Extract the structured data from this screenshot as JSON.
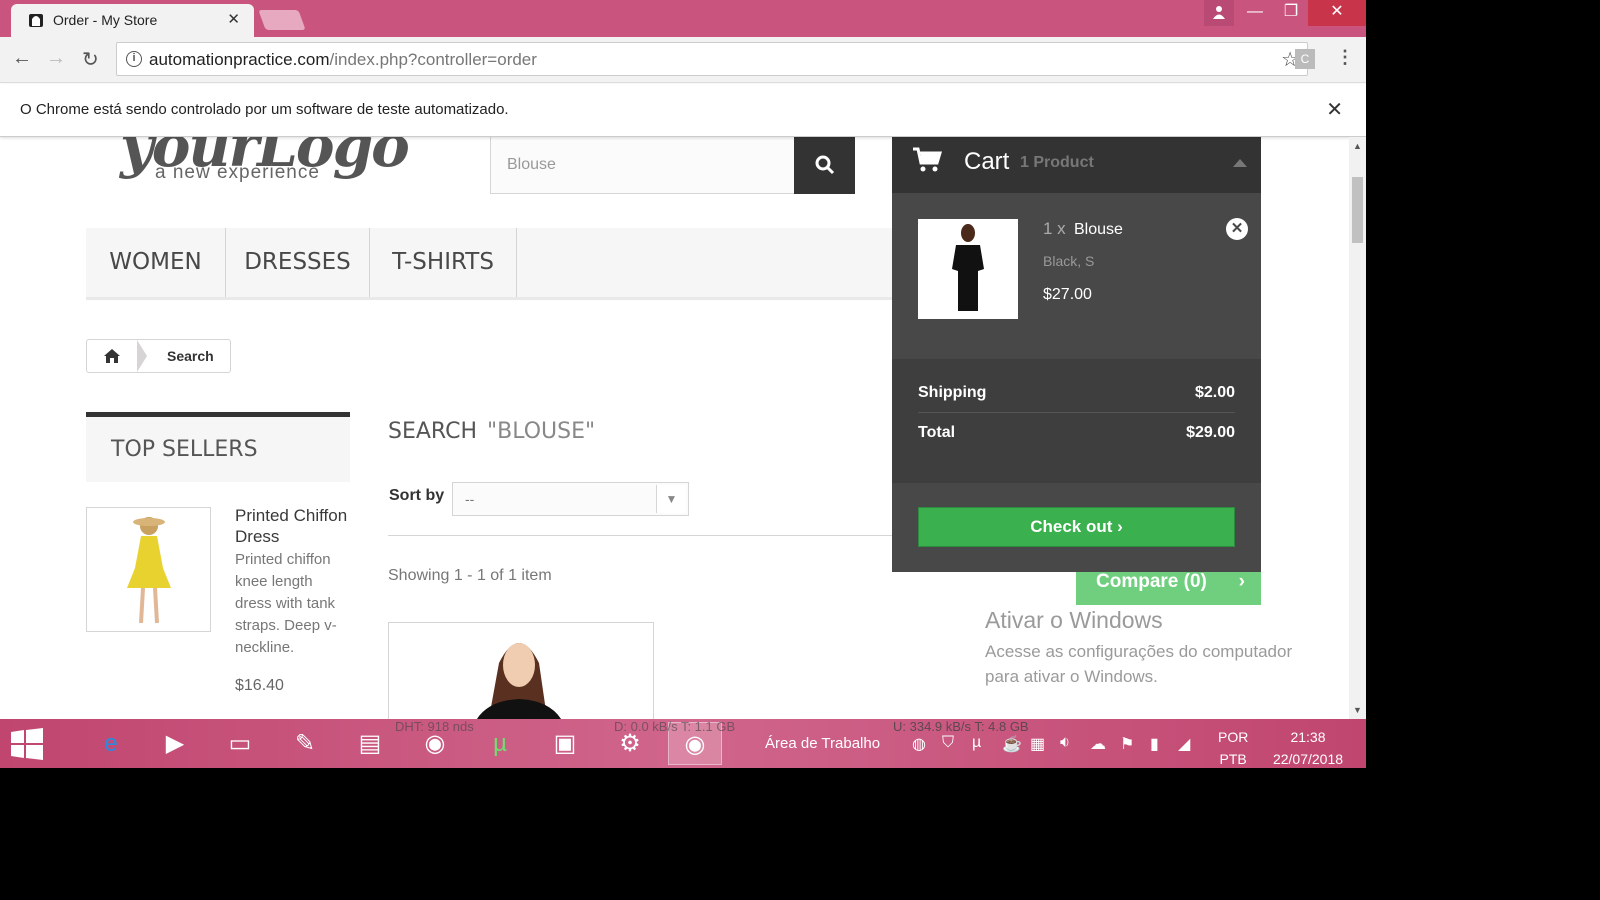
{
  "browser": {
    "tab_title": "Order - My Store",
    "url_domain": "automationpractice.com",
    "url_path": "/index.php?controller=order",
    "infobar_message": "O Chrome está sendo controlado por um software de teste automatizado.",
    "ext_label": "C"
  },
  "header": {
    "logo_main": "yourLogo",
    "logo_tagline": "a new experience",
    "search_value": "Blouse"
  },
  "menu": {
    "items": [
      {
        "label": "WOMEN"
      },
      {
        "label": "DRESSES"
      },
      {
        "label": "T-SHIRTS"
      }
    ]
  },
  "breadcrumb": {
    "current": "Search"
  },
  "sidebar": {
    "heading": "TOP SELLERS",
    "product_name": "Printed Chiffon Dress",
    "product_desc": "Printed chiffon knee length dress with tank straps. Deep v-neckline.",
    "product_price": "$16.40"
  },
  "results": {
    "heading": "SEARCH",
    "query": "\"BLOUSE\"",
    "sort_label": "Sort by",
    "sort_value": "--",
    "showing": "Showing 1 - 1 of 1 item"
  },
  "cart": {
    "title": "Cart",
    "count": "1 Product",
    "item": {
      "qty": "1 x",
      "name": "Blouse",
      "attributes": "Black, S",
      "price": "$27.00"
    },
    "shipping_label": "Shipping",
    "shipping_value": "$2.00",
    "total_label": "Total",
    "total_value": "$29.00",
    "checkout_label": "Check out"
  },
  "compare": {
    "label": "Compare (0)"
  },
  "windows_activation": {
    "heading": "Ativar o Windows",
    "subtext": "Acesse as configurações do computador para ativar o Windows."
  },
  "taskbar": {
    "desktop_label": "Área de Trabalho",
    "tray_note": "U: 334.9 kB/s T: 4.8 GB",
    "tray_note_left": "DHT: 918 nds",
    "tray_note_mid": "D: 0.0 kB/s T: 1.1 GB",
    "language_line1": "POR",
    "language_line2": "PTB",
    "time": "21:38",
    "date": "22/07/2018"
  },
  "colors": {
    "titlebar": "#c9557f",
    "cart_bg": "#484848",
    "checkout_green": "#3bb04e",
    "compare_green": "#6fcf7e"
  }
}
